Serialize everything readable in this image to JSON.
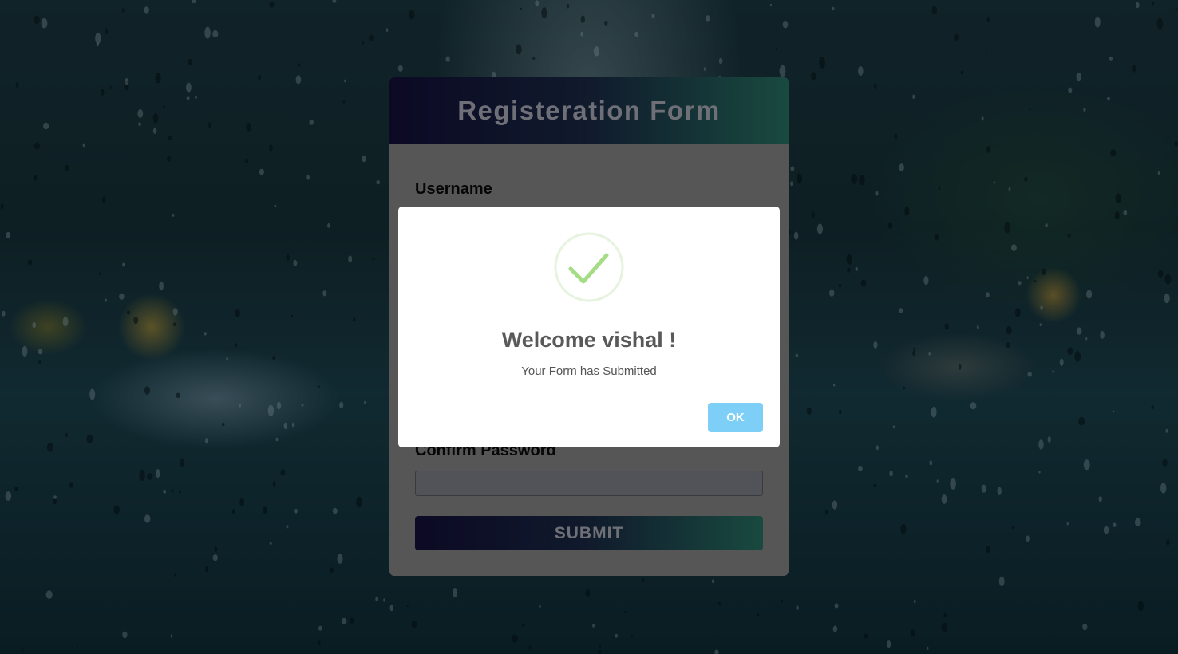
{
  "form": {
    "title": "Registeration Form",
    "fields": [
      {
        "label": "Username"
      },
      {
        "label": "Confirm Password"
      }
    ],
    "submit_label": "SUBMIT"
  },
  "modal": {
    "icon": "success-check-icon",
    "title": "Welcome vishal !",
    "message": "Your Form has Submitted",
    "ok_label": "OK"
  },
  "colors": {
    "header_gradient_start": "#14103d",
    "header_gradient_end": "#2a7b6a",
    "success_green": "#a5dc86",
    "ok_button": "#7dcff7"
  }
}
